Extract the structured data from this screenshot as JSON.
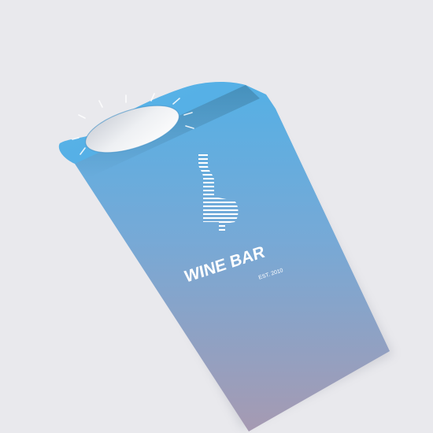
{
  "product": {
    "brand_name": "WINE BAR",
    "tagline": "EST. 2010"
  },
  "colors": {
    "background": "#e9e9ed",
    "card_top": "#55b1e6",
    "card_bottom": "#a59bb3",
    "logo": "#ffffff"
  },
  "icons": {
    "logo": "wine-bottle-glass-icon"
  }
}
